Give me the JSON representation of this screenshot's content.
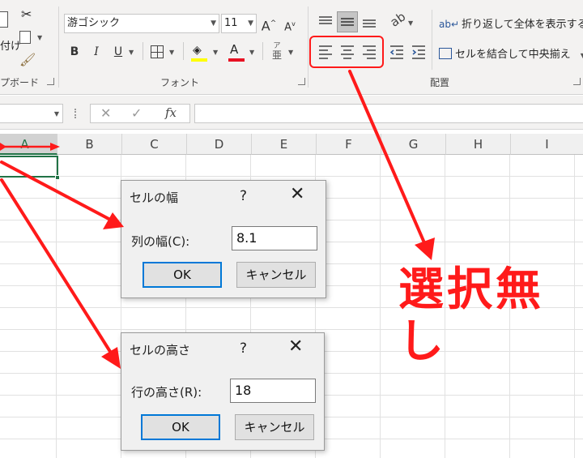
{
  "ribbon": {
    "clipboard": {
      "paste_fragment": "付け",
      "group_label_fragment": "プボード"
    },
    "font": {
      "font_name": "游ゴシック",
      "font_size": "11",
      "bold": "B",
      "italic": "I",
      "underline": "U",
      "phonetic_top": "ア",
      "phonetic_bottom": "亜",
      "group_label": "フォント"
    },
    "alignment": {
      "wrap_text": "折り返して全体を表示する",
      "merge_center": "セルを結合して中央揃え",
      "group_label": "配置"
    }
  },
  "formula_bar": {
    "fx_label": "fx"
  },
  "grid": {
    "columns": [
      "A",
      "B",
      "C",
      "D",
      "E",
      "F",
      "G",
      "H",
      "I"
    ],
    "selected_column": "A"
  },
  "column_width_dialog": {
    "title": "セルの幅",
    "help": "?",
    "close": "✕",
    "label": "列の幅(C):",
    "value": "8.1",
    "ok": "OK",
    "cancel": "キャンセル"
  },
  "row_height_dialog": {
    "title": "セルの高さ",
    "help": "?",
    "close": "✕",
    "label": "行の高さ(R):",
    "value": "18",
    "ok": "OK",
    "cancel": "キャンセル"
  },
  "annotation": {
    "text": "選択無し",
    "color": "#ff1a1a"
  },
  "colors": {
    "accent_green": "#217346",
    "dialog_focus_blue": "#0078d7"
  }
}
